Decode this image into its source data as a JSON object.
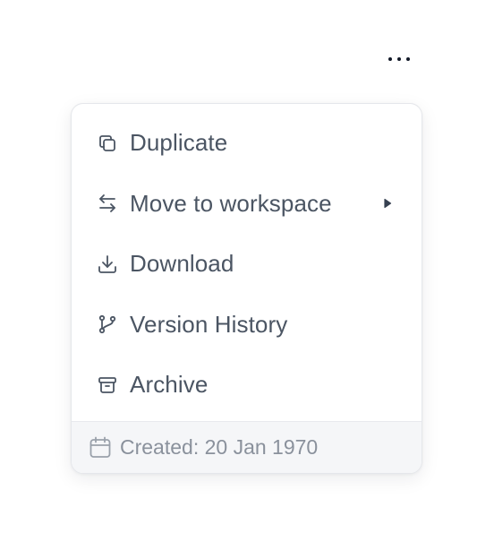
{
  "menu": {
    "items": [
      {
        "label": "Duplicate",
        "icon": "duplicate-icon"
      },
      {
        "label": "Move to workspace",
        "icon": "swap-arrows-icon",
        "has_submenu": true
      },
      {
        "label": "Download",
        "icon": "download-icon"
      },
      {
        "label": "Version History",
        "icon": "git-branch-icon"
      },
      {
        "label": "Archive",
        "icon": "archive-icon"
      }
    ],
    "footer": {
      "text": "Created: 20 Jan 1970",
      "icon": "calendar-icon"
    }
  },
  "colors": {
    "text": "#4b5563",
    "muted_text": "#8a919c",
    "border": "#e5e7eb",
    "footer_bg": "#f5f6f8"
  }
}
